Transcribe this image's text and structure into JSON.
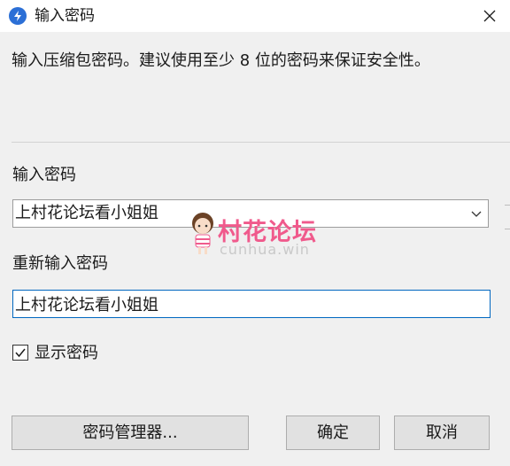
{
  "window": {
    "title": "输入密码",
    "app_icon": "lightning-app-icon",
    "close_icon": "close-icon"
  },
  "description": "输入压缩包密码。建议使用至少 8 位的密码来保证安全性。",
  "password_field": {
    "label": "输入密码",
    "value": "上村花论坛看小姐姐",
    "dropdown_icon": "chevron-down-icon"
  },
  "confirm_field": {
    "label": "重新输入密码",
    "value": "上村花论坛看小姐姐"
  },
  "show_password": {
    "label": "显示密码",
    "checked": true
  },
  "buttons": {
    "manager": "密码管理器...",
    "ok": "确定",
    "cancel": "取消"
  },
  "watermark": {
    "title": "村花论坛",
    "subtitle": "cunhua.win"
  },
  "colors": {
    "accent": "#0067c0",
    "watermark_pink": "#f05a8c"
  }
}
